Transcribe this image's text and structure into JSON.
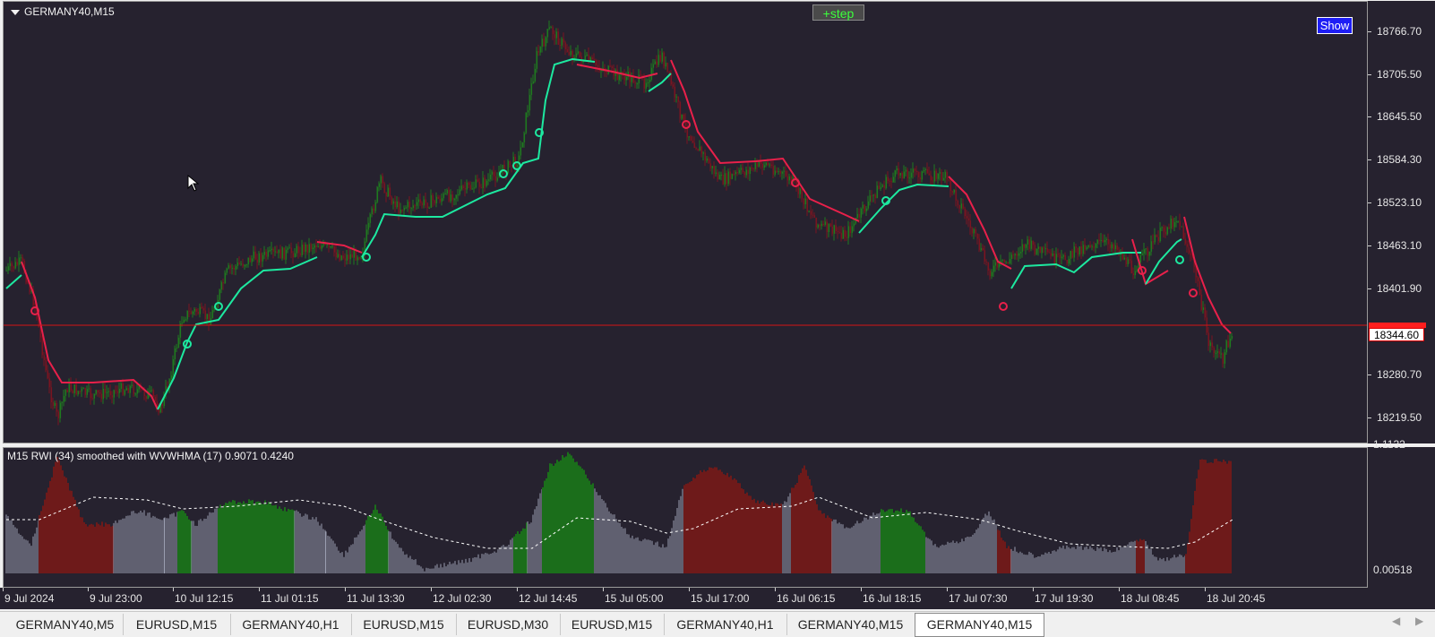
{
  "chart": {
    "symbol_title": "GERMANY40,M15",
    "step_label": "+step",
    "show_label": "Show",
    "current_price": "18344.60",
    "price_levels": [
      "18766.70",
      "18705.50",
      "18645.50",
      "18584.30",
      "18523.10",
      "18463.10",
      "18401.90",
      "18280.70",
      "18219.50"
    ],
    "time_labels": [
      "9 Jul 2024",
      "9 Jul 23:00",
      "10 Jul 12:15",
      "11 Jul 01:15",
      "11 Jul 13:30",
      "12 Jul 02:30",
      "12 Jul 14:45",
      "15 Jul 05:00",
      "15 Jul 17:00",
      "16 Jul 06:15",
      "16 Jul 18:15",
      "17 Jul 07:30",
      "17 Jul 19:30",
      "18 Jul 08:45",
      "18 Jul 20:45"
    ]
  },
  "indicator": {
    "title": "M15 RWI  (34) smoothed with WVWHMA (17) 0.9071 0.4240",
    "max_label": "1.1132",
    "min_label": "0.00518"
  },
  "colors": {
    "background": "#26222f",
    "bull_candle": "#1f7a1f",
    "bear_candle": "#7a1420",
    "trend_up": "#1de9a0",
    "trend_down": "#e8204a",
    "price_line": "#d41414",
    "rwi_bull": "#1b6e1b",
    "rwi_bear": "#6e1a1a",
    "rwi_neutral": "#9a9eb0"
  },
  "tabs": [
    {
      "label": "GERMANY40,M5",
      "active": false
    },
    {
      "label": "EURUSD,M15",
      "active": false
    },
    {
      "label": "GERMANY40,H1",
      "active": false
    },
    {
      "label": "EURUSD,M15",
      "active": false
    },
    {
      "label": "EURUSD,M30",
      "active": false
    },
    {
      "label": "EURUSD,M15",
      "active": false
    },
    {
      "label": "GERMANY40,H1",
      "active": false
    },
    {
      "label": "GERMANY40,M15",
      "active": false
    },
    {
      "label": "GERMANY40,M15",
      "active": true
    }
  ]
}
